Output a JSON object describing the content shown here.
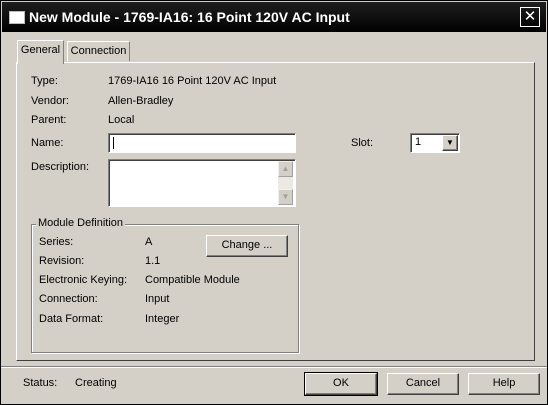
{
  "window": {
    "title": "New Module - 1769-IA16: 16 Point 120V AC Input",
    "close_glyph": "✕"
  },
  "tabs": [
    {
      "label": "General",
      "active": true
    },
    {
      "label": "Connection",
      "active": false
    }
  ],
  "general": {
    "type_label": "Type:",
    "type_value": "1769-IA16 16 Point 120V AC Input",
    "vendor_label": "Vendor:",
    "vendor_value": "Allen-Bradley",
    "parent_label": "Parent:",
    "parent_value": "Local",
    "name_label": "Name:",
    "name_value": "",
    "description_label": "Description:",
    "description_value": "",
    "slot_label": "Slot:",
    "slot_value": "1"
  },
  "module_definition": {
    "title": "Module Definition",
    "series_label": "Series:",
    "series_value": "A",
    "revision_label": "Revision:",
    "revision_value": "1.1",
    "keying_label": "Electronic Keying:",
    "keying_value": "Compatible Module",
    "connection_label": "Connection:",
    "connection_value": "Input",
    "data_format_label": "Data Format:",
    "data_format_value": "Integer",
    "change_button": "Change ..."
  },
  "footer": {
    "status_label": "Status:",
    "status_value": "Creating",
    "ok": "OK",
    "cancel": "Cancel",
    "help": "Help"
  },
  "icons": {
    "app": "window-icon",
    "close": "close-icon",
    "dropdown": "dropdown-arrow-icon",
    "scroll_up": "scroll-up-icon",
    "scroll_down": "scroll-down-icon"
  }
}
